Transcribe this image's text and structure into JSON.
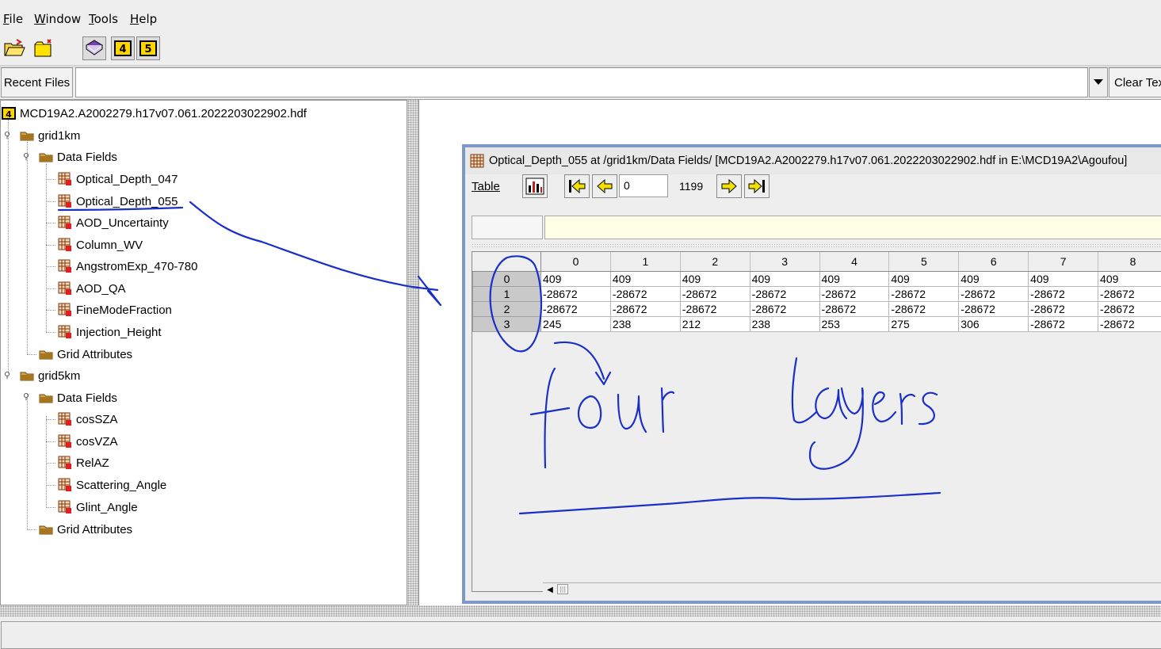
{
  "menu": [
    "File",
    "Window",
    "Tools",
    "Help"
  ],
  "recent": {
    "button": "Recent Files",
    "field_value": "",
    "clear": "Clear Text"
  },
  "tree": {
    "root": "MCD19A2.A2002279.h17v07.061.2022203022902.hdf",
    "grid1km": {
      "label": "grid1km",
      "data_fields": "Data Fields",
      "items": [
        "Optical_Depth_047",
        "Optical_Depth_055",
        "AOD_Uncertainty",
        "Column_WV",
        "AngstromExp_470-780",
        "AOD_QA",
        "FineModeFraction",
        "Injection_Height"
      ],
      "attributes": "Grid Attributes"
    },
    "grid5km": {
      "label": "grid5km",
      "data_fields": "Data Fields",
      "items": [
        "cosSZA",
        "cosVZA",
        "RelAZ",
        "Scattering_Angle",
        "Glint_Angle"
      ],
      "attributes": "Grid Attributes"
    }
  },
  "frame": {
    "title": "Optical_Depth_055  at  /grid1km/Data Fields/  [MCD19A2.A2002279.h17v07.061.2022203022902.hdf  in  E:\\MCD19A2\\Agoufou]",
    "table_menu": "Table",
    "page_value": "0",
    "page_max": "1199"
  },
  "table": {
    "columns": [
      "0",
      "1",
      "2",
      "3",
      "4",
      "5",
      "6",
      "7",
      "8"
    ],
    "rows": [
      {
        "label": "0",
        "cells": [
          "409",
          "409",
          "409",
          "409",
          "409",
          "409",
          "409",
          "409",
          "409"
        ]
      },
      {
        "label": "1",
        "cells": [
          "-28672",
          "-28672",
          "-28672",
          "-28672",
          "-28672",
          "-28672",
          "-28672",
          "-28672",
          "-28672"
        ]
      },
      {
        "label": "2",
        "cells": [
          "-28672",
          "-28672",
          "-28672",
          "-28672",
          "-28672",
          "-28672",
          "-28672",
          "-28672",
          "-28672"
        ]
      },
      {
        "label": "3",
        "cells": [
          "245",
          "238",
          "212",
          "238",
          "253",
          "275",
          "306",
          "-28672",
          "-28672"
        ]
      }
    ]
  },
  "annotation": {
    "text": "four layers",
    "color": "#1a2fc8"
  }
}
